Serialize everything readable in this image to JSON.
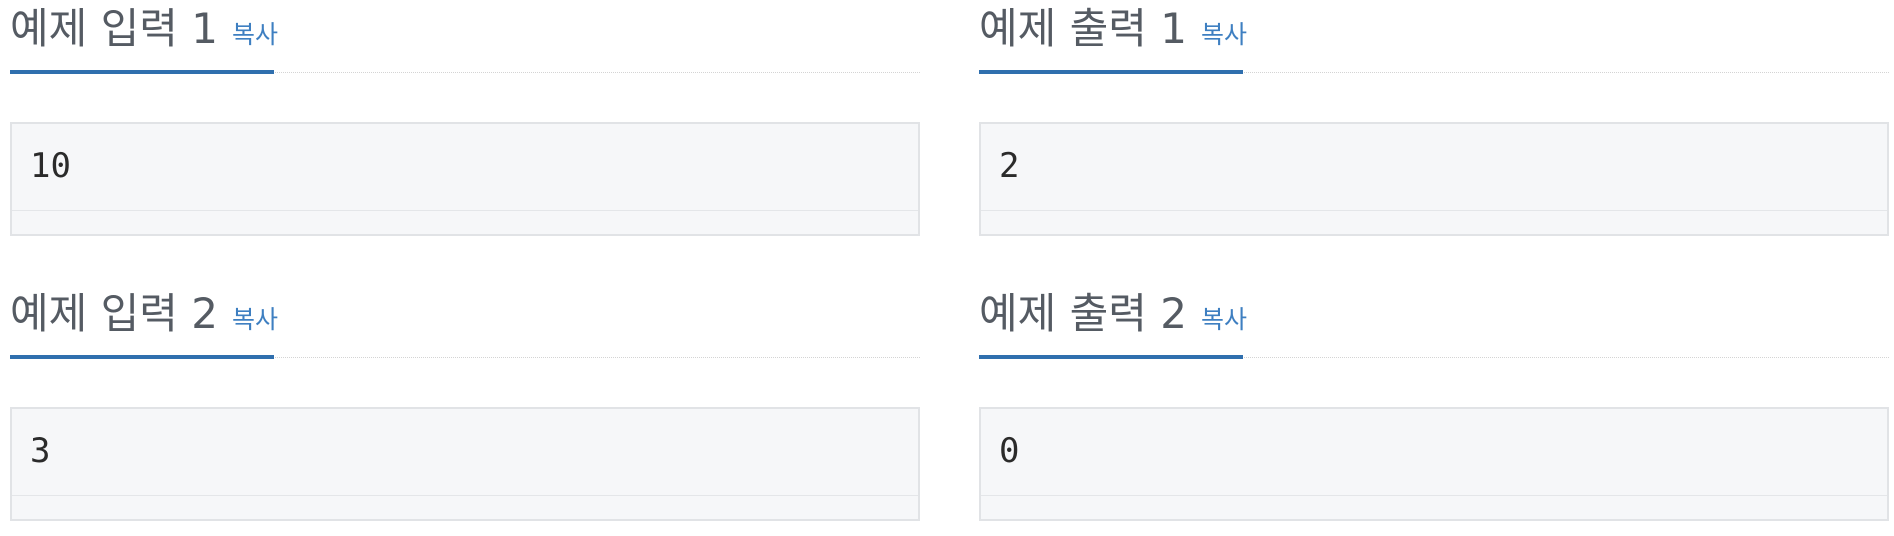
{
  "copy_label": "복사",
  "samples": [
    {
      "title": "예제 입력 1",
      "value": "10"
    },
    {
      "title": "예제 출력 1",
      "value": "2"
    },
    {
      "title": "예제 입력 2",
      "value": "3"
    },
    {
      "title": "예제 출력 2",
      "value": "0"
    }
  ]
}
